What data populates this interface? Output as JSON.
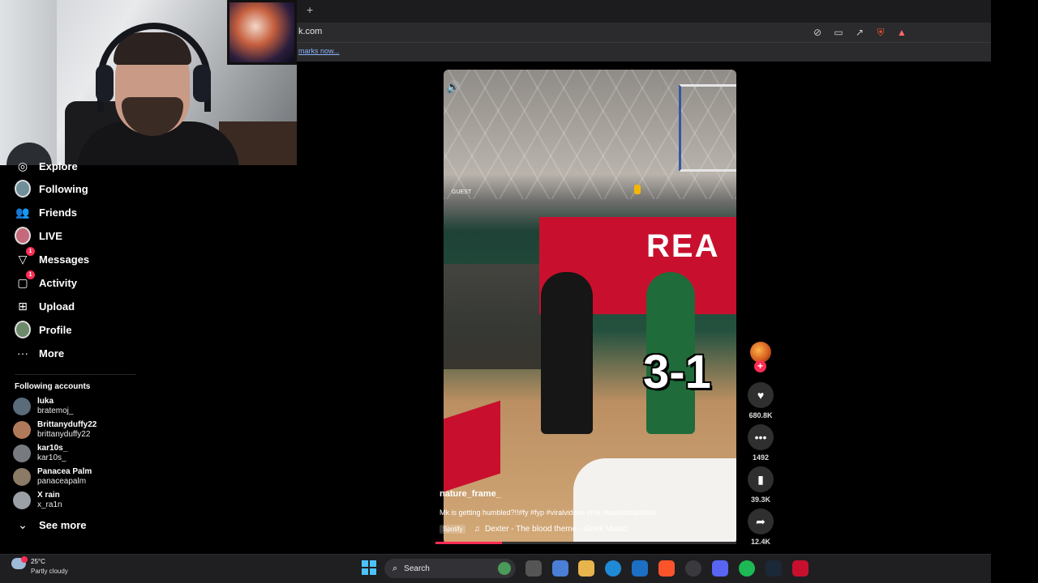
{
  "browser": {
    "new_tab_icon": "+",
    "url": "k.com",
    "bookmarks_prompt": "marks now...",
    "toolbar_icons": [
      "video-off-icon",
      "cast-icon",
      "share-icon",
      "brave-shield-icon",
      "brave-rewards-icon"
    ]
  },
  "sidebar": {
    "items": [
      {
        "label": "Explore",
        "icon": "compass-icon"
      },
      {
        "label": "Following",
        "icon": "avatar"
      },
      {
        "label": "Friends",
        "icon": "users-icon"
      },
      {
        "label": "LIVE",
        "icon": "live-avatar"
      },
      {
        "label": "Messages",
        "icon": "send-icon",
        "badge": "1"
      },
      {
        "label": "Activity",
        "icon": "message-square-icon",
        "badge": "1"
      },
      {
        "label": "Upload",
        "icon": "plus-square-icon"
      },
      {
        "label": "Profile",
        "icon": "profile-avatar"
      },
      {
        "label": "More",
        "icon": "ellipsis-icon"
      }
    ],
    "following_title": "Following accounts",
    "accounts": [
      {
        "name": "luka",
        "username": "bratemoj_",
        "color": "#5a6b7a"
      },
      {
        "name": "Brittanyduffy22",
        "username": "brittanyduffy22",
        "color": "#b07a5a"
      },
      {
        "name": "kar10s_",
        "username": "kar10s_",
        "color": "#777b80"
      },
      {
        "name": "Panacea Palm",
        "username": "panaceapalm",
        "color": "#8a7a66"
      },
      {
        "name": "X rain",
        "username": "x_ra1n",
        "color": "#9aa0a6"
      }
    ],
    "see_more": "See more"
  },
  "video": {
    "overlay_text": "3-1",
    "banner_text": "REA",
    "scoreboard_label": "GUEST",
    "author": "nature_frame_",
    "caption": "Mk is getting humbled?!!#fy #fyp #viralvideos #mk #basketballtiktok",
    "music_source": "Spotify",
    "music_track": "Dexter - The blood theme - Geek Music",
    "progress": 0.22
  },
  "actions": {
    "likes": "680.8K",
    "comments": "1492",
    "saves": "39.3K",
    "shares": "12.4K"
  },
  "taskbar": {
    "temperature": "25°C",
    "condition": "Partly cloudy",
    "search_placeholder": "Search"
  },
  "colors": {
    "accent": "#fe2c55",
    "background": "#000000",
    "brand_blue": "#4cc2ff"
  }
}
